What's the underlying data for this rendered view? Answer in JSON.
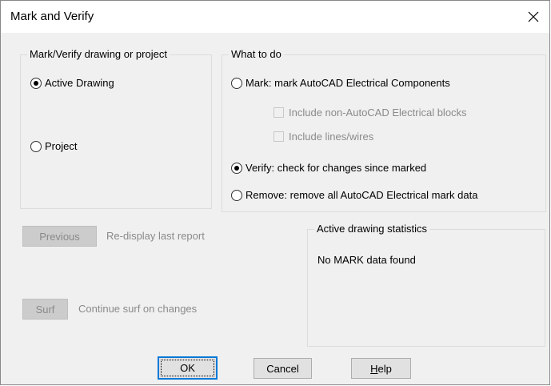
{
  "window": {
    "title": "Mark and Verify",
    "close_icon": "close-icon"
  },
  "scope_group": {
    "legend": "Mark/Verify drawing or project",
    "options": [
      {
        "label": "Active Drawing",
        "checked": true
      },
      {
        "label": "Project",
        "checked": false
      }
    ]
  },
  "action_group": {
    "legend": "What to do",
    "mark_label": "Mark: mark AutoCAD Electrical Components",
    "include_blocks_label": "Include non-AutoCAD Electrical blocks",
    "include_lines_label": "Include lines/wires",
    "verify_label": "Verify: check for changes since marked",
    "remove_label": "Remove: remove all AutoCAD Electrical mark data",
    "selected": "Verify"
  },
  "previous": {
    "button_label": "Previous",
    "description": "Re-display last report"
  },
  "surf": {
    "button_label": "Surf",
    "description": "Continue surf on changes"
  },
  "stats_group": {
    "legend": "Active drawing statistics",
    "message": "No MARK data found"
  },
  "footer": {
    "ok_label": "OK",
    "cancel_label": "Cancel",
    "help_first": "H",
    "help_rest": "elp"
  },
  "colors": {
    "dialog_bg": "#f0f0f0",
    "disabled_text": "#8a8a8a",
    "default_button_border": "#0078d7"
  }
}
